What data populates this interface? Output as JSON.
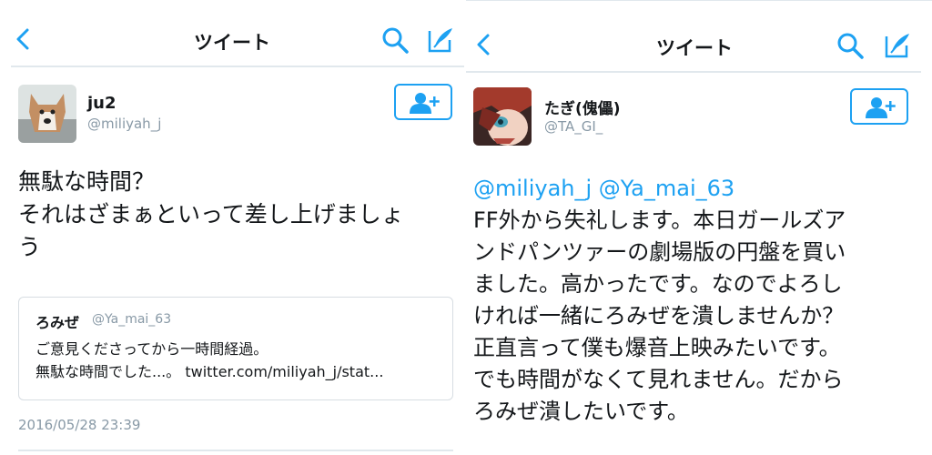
{
  "left": {
    "header": {
      "title": "ツイート"
    },
    "author": {
      "name": "ju2",
      "handle": "@miliyah_j"
    },
    "tweet": {
      "line1": "無駄な時間？",
      "line2": "それはざまぁといって差し上げましょ",
      "line3": "う"
    },
    "quote": {
      "name": "ろみぜ",
      "handle": "@Ya_mai_63",
      "line1": "ご意見くださってから一時間経過。",
      "line2": "無駄な時間でした...。 twitter.com/miliyah_j/stat..."
    },
    "timestamp": "2016/05/28 23:39"
  },
  "right": {
    "header": {
      "title": "ツイート"
    },
    "author": {
      "name": "たぎ(傀儡)",
      "handle": "@TA_GI_"
    },
    "tweet": {
      "mentions": "@miliyah_j @Ya_mai_63",
      "line1": "FF外から失礼します。本日ガールズア",
      "line2": "ンドパンツァーの劇場版の円盤を買い",
      "line3": "ました。高かったです。なのでよろし",
      "line4": "ければ一緒にろみぜを潰しませんか？",
      "line5": "正直言って僕も爆音上映みたいです。",
      "line6": "でも時間がなくて見れません。だから",
      "line7": "ろみぜ潰したいです。"
    }
  },
  "colors": {
    "accent": "#1da1f2",
    "secondary_text": "#8899a6",
    "divider": "#e1e8ed"
  },
  "icons": [
    "chevron-left-icon",
    "search-icon",
    "compose-tweet-icon",
    "follow-user-icon"
  ]
}
